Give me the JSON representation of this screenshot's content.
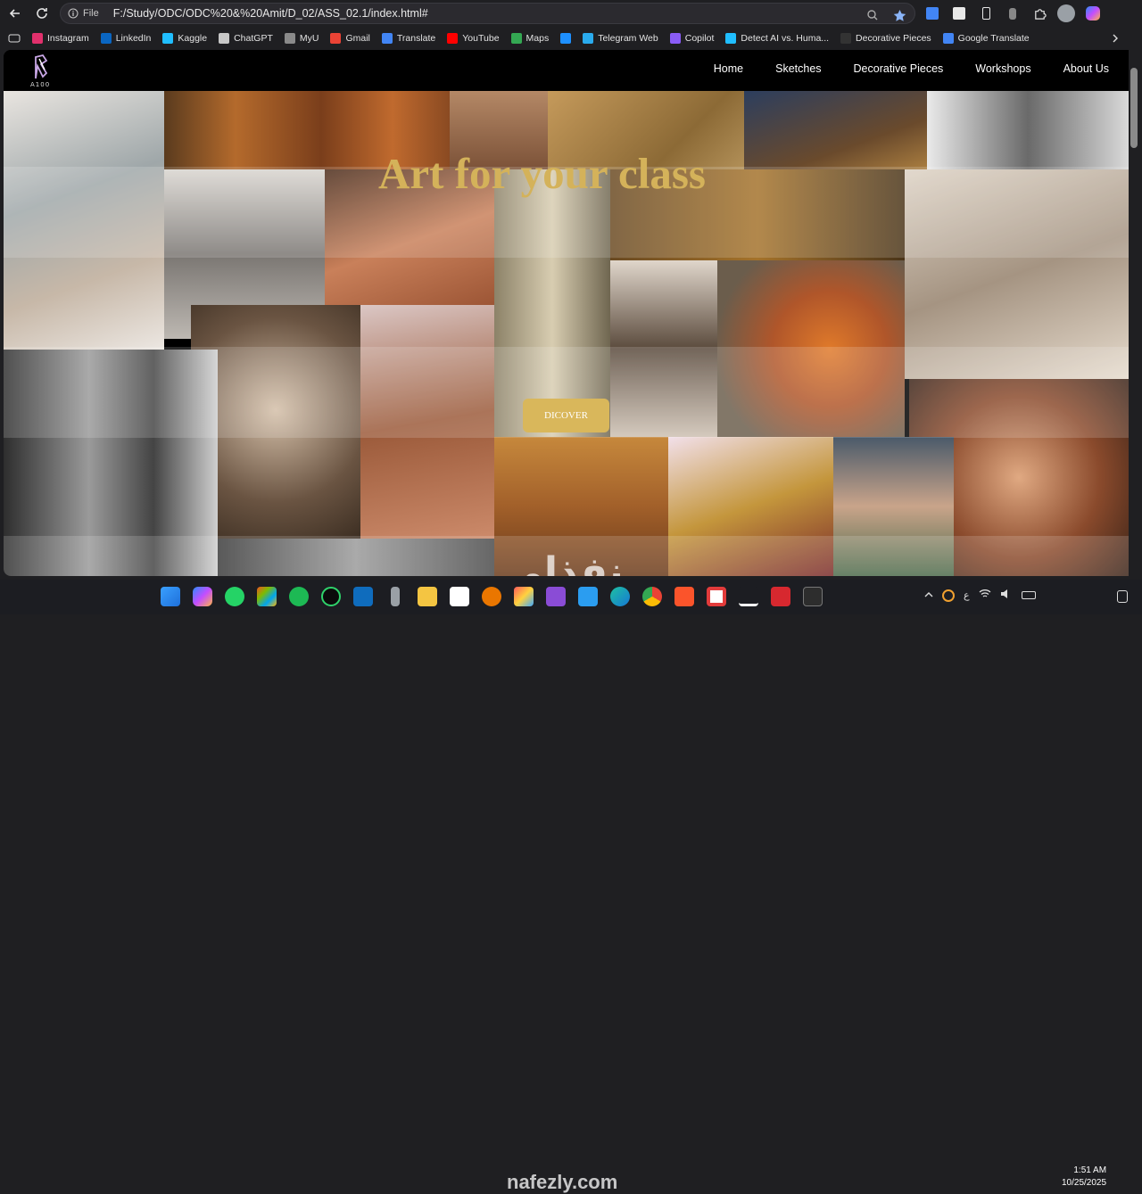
{
  "browser": {
    "omnibox": {
      "info_label": "File",
      "url": "F:/Study/ODC/ODC%20&%20Amit/D_02/ASS_02.1/index.html#"
    },
    "bookmarks": [
      {
        "label": "Instagram",
        "color": "#e1306c"
      },
      {
        "label": "LinkedIn",
        "color": "#0a66c2"
      },
      {
        "label": "Kaggle",
        "color": "#20beff"
      },
      {
        "label": "ChatGPT",
        "color": "#c7c7c7"
      },
      {
        "label": "MyU",
        "color": "#8a8a8a"
      },
      {
        "label": "Gmail",
        "color": "#ea4335"
      },
      {
        "label": "Translate",
        "color": "#4285f4"
      },
      {
        "label": "YouTube",
        "color": "#ff0000"
      },
      {
        "label": "Maps",
        "color": "#34a853"
      },
      {
        "label": "",
        "color": "#1e90ff"
      },
      {
        "label": "Telegram Web",
        "color": "#2aabee"
      },
      {
        "label": "Copilot",
        "color": "#8a5cf6"
      },
      {
        "label": "Detect AI vs. Huma...",
        "color": "#20beff"
      },
      {
        "label": "Decorative Pieces",
        "color": "#333333"
      },
      {
        "label": "Google Translate",
        "color": "#4285f4"
      }
    ]
  },
  "site": {
    "logo_text": "A100",
    "menu": [
      "Home",
      "Sketches",
      "Decorative Pieces",
      "Workshops",
      "About Us"
    ],
    "hero_title": "Art for your class",
    "cta_label": "DICOVER",
    "accent": "#d9b75b"
  },
  "watermark": {
    "arabic": "نفذلي",
    "latin": "nafezly.com"
  },
  "taskbar": {
    "time": "1:51 AM",
    "date": "10/25/2025",
    "lang": "ع"
  }
}
